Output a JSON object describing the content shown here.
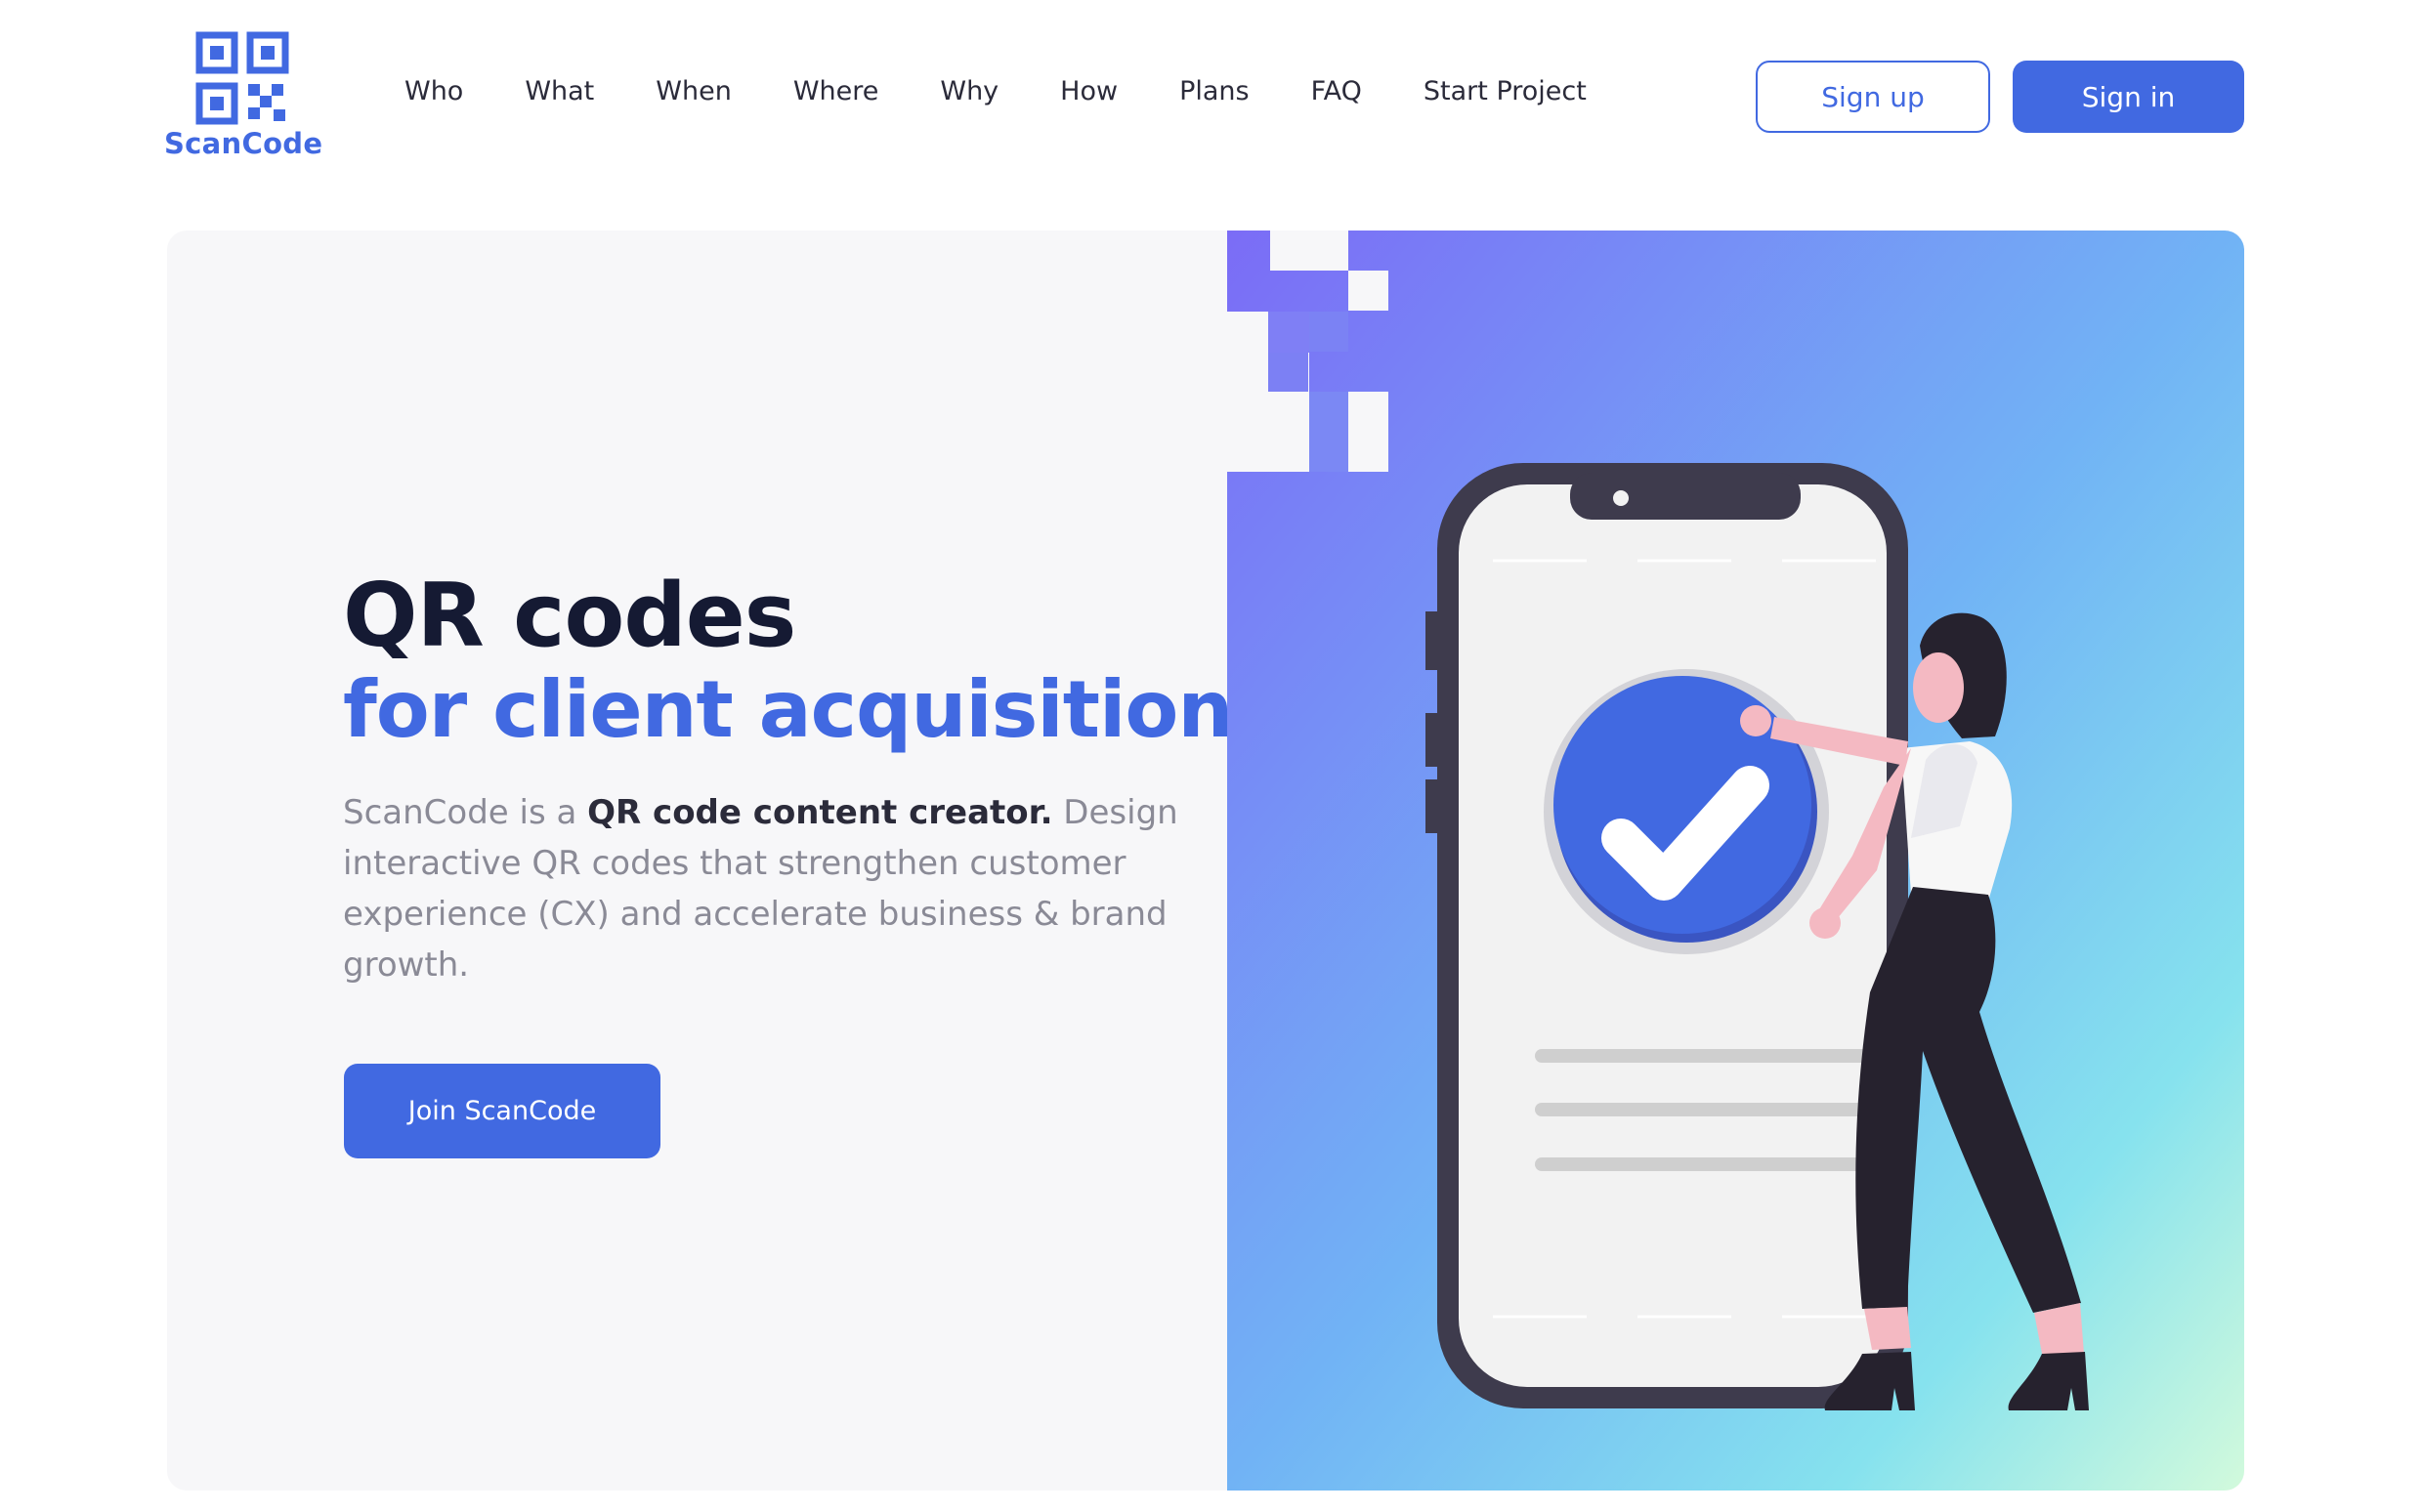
{
  "brand": {
    "name": "ScanCode",
    "color": "#4169e1"
  },
  "nav": {
    "items": [
      {
        "label": "Who"
      },
      {
        "label": "What"
      },
      {
        "label": "When"
      },
      {
        "label": "Where"
      },
      {
        "label": "Why"
      },
      {
        "label": "How"
      },
      {
        "label": "Plans"
      },
      {
        "label": "FAQ"
      },
      {
        "label": "Start Project"
      }
    ]
  },
  "auth": {
    "signup_label": "Sign up",
    "signin_label": "Sign in"
  },
  "hero": {
    "title_line1": "QR codes",
    "title_line2": "for client acquisition",
    "desc_prefix": "ScanCode is a ",
    "desc_bold": "QR code content creator.",
    "desc_rest": " Design interactive QR codes that strengthen customer experience (CX) and accelerate business & brand growth.",
    "cta_label": "Join ScanCode"
  },
  "illustration": {
    "gradient_start": "#7b6cf6",
    "gradient_mid": "#71b3f5",
    "gradient_end": "#d2fadc",
    "phone_color": "#3e3b4d",
    "check_color": "#4169e1",
    "icons": [
      "qr-code-icon",
      "phone-icon",
      "check-circle-icon",
      "person-icon"
    ]
  }
}
